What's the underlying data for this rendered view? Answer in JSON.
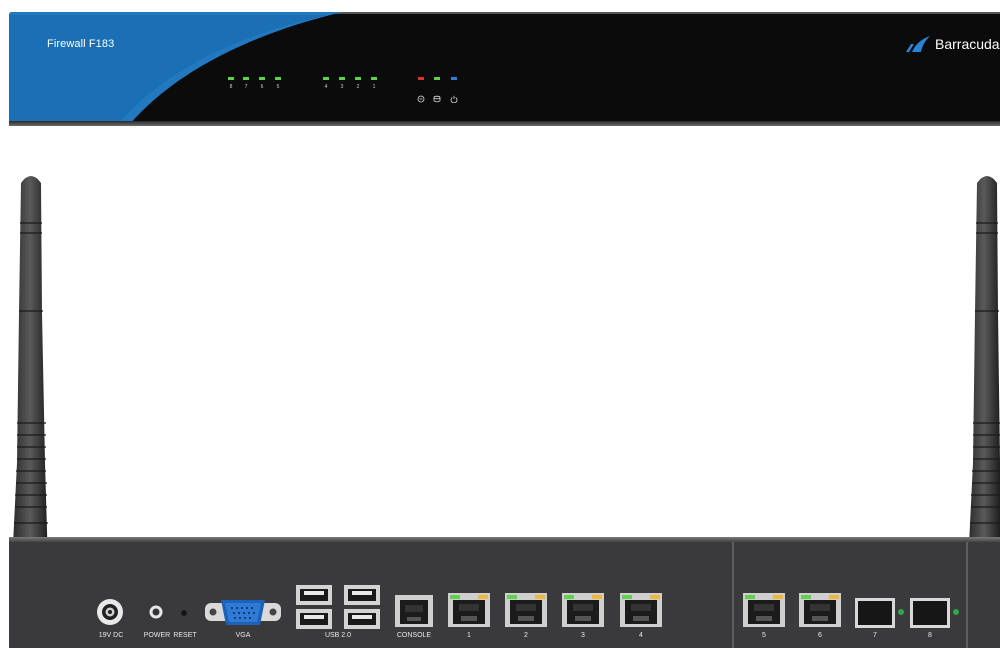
{
  "front_panel": {
    "model": "Firewall F183",
    "brand": "Barracuda",
    "led_labels": [
      "8",
      "7",
      "6",
      "5",
      "4",
      "3",
      "2",
      "1"
    ],
    "colors": {
      "swoosh": "#1a6fb5",
      "port_led": "#5fd14a",
      "alarm_led": "#e0302a",
      "power_led": "#2f7bd6"
    }
  },
  "rear_panel": {
    "labels": {
      "dc": "19V DC",
      "power": "POWER",
      "reset": "RESET",
      "vga": "VGA",
      "usb": "USB 2.0",
      "console": "CONSOLE",
      "port1": "1",
      "port2": "2",
      "port3": "3",
      "port4": "4",
      "port5": "5",
      "port6": "6",
      "port7": "7",
      "port8": "8"
    }
  }
}
